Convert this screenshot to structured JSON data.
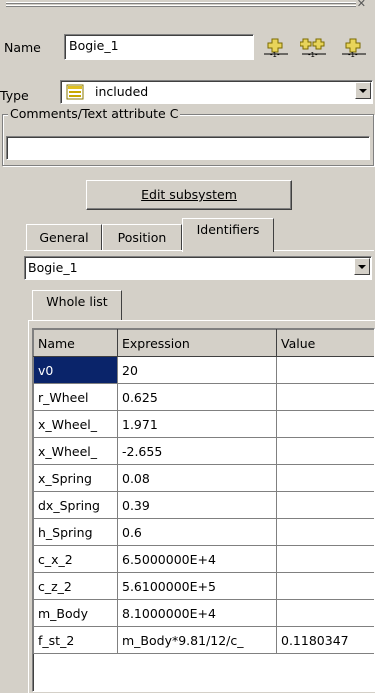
{
  "form": {
    "name_label": "Name",
    "name_value": "Bogie_1",
    "type_label": "Type",
    "type_value": "included",
    "comments_label": "Comments/Text attribute C",
    "comments_value": "",
    "edit_button": "Edit subsystem",
    "icon_buttons": [
      "add-node-icon",
      "add-nodes-icon",
      "add-node-icon"
    ]
  },
  "tabs": [
    {
      "label": "General",
      "active": false
    },
    {
      "label": "Position",
      "active": false
    },
    {
      "label": "Identifiers",
      "active": true
    }
  ],
  "subsystem_select": {
    "value": "Bogie_1"
  },
  "subtab": {
    "label": "Whole list"
  },
  "table": {
    "headers": [
      "Name",
      "Expression",
      "Value"
    ],
    "rows": [
      [
        "v0",
        "20",
        ""
      ],
      [
        "r_Wheel",
        "0.625",
        ""
      ],
      [
        "x_Wheel_",
        "1.971",
        ""
      ],
      [
        "x_Wheel_",
        "-2.655",
        ""
      ],
      [
        "x_Spring",
        "0.08",
        ""
      ],
      [
        "dx_Spring",
        "0.39",
        ""
      ],
      [
        "h_Spring",
        "0.6",
        ""
      ],
      [
        "c_x_2",
        "6.5000000E+4",
        ""
      ],
      [
        "c_z_2",
        "5.6100000E+5",
        ""
      ],
      [
        "m_Body",
        "8.1000000E+4",
        ""
      ],
      [
        "f_st_2",
        "m_Body*9.81/12/c_",
        "0.1180347"
      ]
    ],
    "selected_row": 0
  },
  "colors": {
    "face": "#d4d0c8",
    "selection": "#0a246a",
    "icon_yellow": "#c8a800"
  }
}
